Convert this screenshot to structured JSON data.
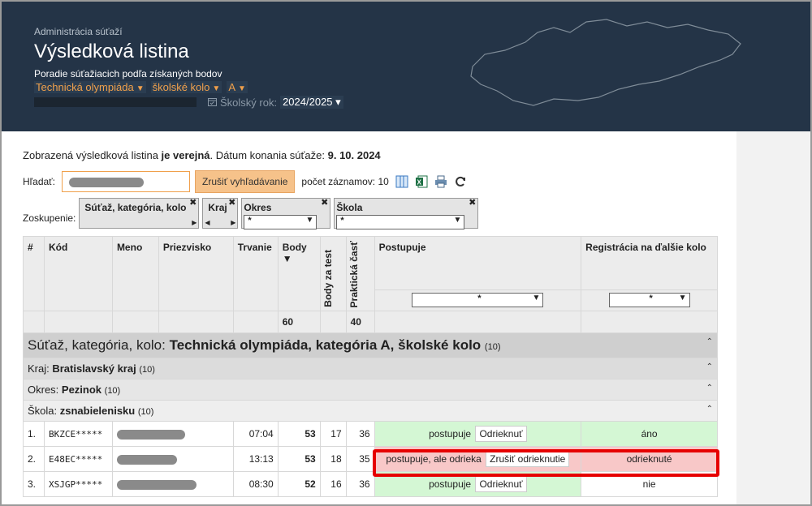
{
  "header": {
    "crumb": "Administrácia súťaží",
    "title": "Výsledková listina",
    "subtitle": "Poradie súťažiacich podľa získaných bodov",
    "competition": "Technická olympiáda",
    "round": "školské kolo",
    "category": "A",
    "year_label": "Školský rok:",
    "year_value": "2024/2025"
  },
  "info": {
    "prefix": "Zobrazená výsledková listina ",
    "public": "je verejná",
    "date_label": ". Dátum konania súťaže: ",
    "date": "9. 10. 2024"
  },
  "search": {
    "label": "Hľadať:",
    "cancel": "Zrušiť vyhľadávanie",
    "count": "počet záznamov: 10"
  },
  "grouping": {
    "label": "Zoskupenie:",
    "chip1": "Súťaž, kategória, kolo",
    "chip2": "Kraj",
    "chip3": "Okres",
    "chip4": "Škola",
    "filter_value": "*"
  },
  "table": {
    "headers": {
      "num": "#",
      "code": "Kód",
      "name": "Meno",
      "surname": "Priezvisko",
      "duration": "Trvanie",
      "points": "Body",
      "test_points": "Body za test",
      "practical": "Praktická časť",
      "advances": "Postupuje",
      "registration": "Registrácia na ďalšie kolo"
    },
    "max_points": "60",
    "max_practical": "40",
    "filter_value": "*",
    "group1": {
      "label": "Súťaž, kategória, kolo: ",
      "value": "Technická olympiáda, kategória A, školské kolo",
      "count": "(10)"
    },
    "group2": {
      "label": "Kraj: ",
      "value": "Bratislavský kraj",
      "count": "(10)"
    },
    "group3": {
      "label": "Okres: ",
      "value": "Pezinok",
      "count": "(10)"
    },
    "group4": {
      "label": "Škola: ",
      "value": "zsnabielenisku",
      "count": "(10)"
    },
    "rows": [
      {
        "num": "1.",
        "code": "BKZCE*****",
        "time": "07:04",
        "points": "53",
        "test": "17",
        "practical": "36",
        "status": "postupuje",
        "action": "Odrieknuť",
        "registration": "áno"
      },
      {
        "num": "2.",
        "code": "E48EC*****",
        "time": "13:13",
        "points": "53",
        "test": "18",
        "practical": "35",
        "status": "postupuje, ale odrieka",
        "action": "Zrušiť odrieknutie",
        "registration": "odrieknuté"
      },
      {
        "num": "3.",
        "code": "XSJGP*****",
        "time": "08:30",
        "points": "52",
        "test": "16",
        "practical": "36",
        "status": "postupuje",
        "action": "Odrieknuť",
        "registration": "nie"
      }
    ]
  },
  "colors": {
    "header_bg": "#243447",
    "accent": "#f0a04b",
    "green": "#d4f7d4",
    "pink": "#f8c8c8",
    "highlight": "#e60000"
  }
}
